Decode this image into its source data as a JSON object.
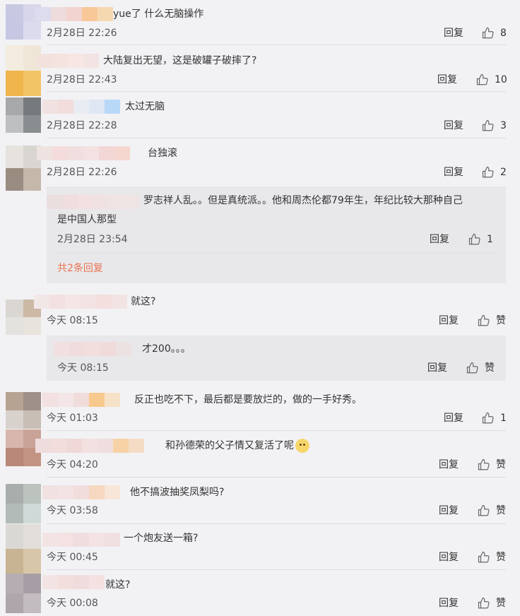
{
  "comments": [
    {
      "text": "yue了  什么无脑操作",
      "time": "2月28日 22:26",
      "reply": "回复",
      "likes": "8"
    },
    {
      "text": "大陆复出无望，这是破罐子破摔了?",
      "time": "2月28日 22:43",
      "reply": "回复",
      "likes": "10"
    },
    {
      "text": "太过无脑",
      "time": "2月28日 22:28",
      "reply": "回复",
      "likes": "3"
    },
    {
      "text": "台独滚",
      "time": "2月28日 22:26",
      "reply": "回复",
      "likes": "2",
      "sub_reply": {
        "text_line1": "罗志祥人乱。。但是真统派。。他和周杰伦都79年生，年纪比较大那种自己",
        "text_line2": "是中国人那型",
        "time": "2月28日 23:54",
        "reply": "回复",
        "likes": "1"
      },
      "more": "共2条回复"
    },
    {
      "text": "就这?",
      "time": "今天 08:15",
      "reply": "回复",
      "likes": "赞",
      "sub_reply": {
        "text": "才200。。。",
        "time": "今天 08:15",
        "reply": "回复",
        "likes": "赞"
      }
    },
    {
      "text": "反正也吃不下，最后都是要放烂的，做的一手好秀。",
      "time": "今天 01:03",
      "reply": "回复",
      "likes": "1"
    },
    {
      "text": "和孙德荣的父子情又复活了呢",
      "time": "今天 04:20",
      "reply": "回复",
      "likes": "赞"
    },
    {
      "text": "他不搞波抽奖凤梨吗?",
      "time": "今天 03:58",
      "reply": "回复",
      "likes": "赞"
    },
    {
      "text": "一个炮友送一箱?",
      "time": "今天 00:45",
      "reply": "回复",
      "likes": "赞"
    },
    {
      "text": "就这?",
      "time": "今天 00:08",
      "reply": "回复",
      "likes": "赞"
    }
  ],
  "icons": {
    "like": "thumbs-up-icon",
    "emoji": "doge-emoji-icon"
  },
  "colors": {
    "background": "#f2f2f5",
    "subreply_bg": "#e8e8eb",
    "more_link": "#eb7350"
  }
}
